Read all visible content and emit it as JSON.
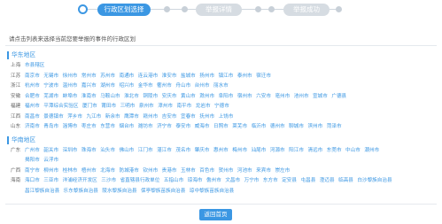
{
  "stepper": {
    "steps": [
      {
        "label": "行政区划选择",
        "active": true
      },
      {
        "label": "举报详情",
        "active": false
      },
      {
        "label": "举报成功",
        "active": false
      }
    ]
  },
  "hint": "请点击列表来选择当前您要举报的事件的行政区划",
  "regions": [
    {
      "title": "华东地区",
      "provinces": [
        {
          "name": "上海",
          "cities": [
            "市县辖区"
          ]
        },
        {
          "name": "江苏",
          "cities": [
            "南京市",
            "无锡市",
            "徐州市",
            "常州市",
            "苏州市",
            "南通市",
            "连云港市",
            "淮安市",
            "盐城市",
            "扬州市",
            "镇江市",
            "泰州市",
            "宿迁市"
          ]
        },
        {
          "name": "浙江",
          "cities": [
            "杭州市",
            "宁波市",
            "温州市",
            "嘉兴市",
            "湖州市",
            "绍兴市",
            "金华市",
            "衢州市",
            "舟山市",
            "台州市",
            "丽水市"
          ]
        },
        {
          "name": "安徽",
          "cities": [
            "合肥市",
            "芜湖市",
            "蚌埠市",
            "淮南市",
            "马鞍山市",
            "淮北市",
            "铜陵市",
            "安庆市",
            "黄山市",
            "滁州市",
            "阜阳市",
            "宿州市",
            "六安市",
            "亳州市",
            "池州市",
            "宣城市",
            "广德县"
          ]
        },
        {
          "name": "福建",
          "cities": [
            "福州市",
            "平潭综合实验区",
            "厦门市",
            "莆田市",
            "三明市",
            "泉州市",
            "漳州市",
            "南平市",
            "龙岩市",
            "宁德市"
          ]
        },
        {
          "name": "江西",
          "cities": [
            "南昌市",
            "景德镇市",
            "萍乡市",
            "九江市",
            "新余市",
            "鹰潭市",
            "赣州市",
            "吉安市",
            "宜春市",
            "抚州市",
            "上饶市"
          ]
        },
        {
          "name": "山东",
          "cities": [
            "济南市",
            "青岛市",
            "淄博市",
            "枣庄市",
            "东营市",
            "烟台市",
            "潍坊市",
            "济宁市",
            "泰安市",
            "威海市",
            "日照市",
            "莱芜市",
            "临沂市",
            "德州市",
            "聊城市",
            "滨州市",
            "菏泽市"
          ]
        }
      ]
    },
    {
      "title": "华南地区",
      "provinces": [
        {
          "name": "广东",
          "cities": [
            "广州市",
            "韶关市",
            "深圳市",
            "珠海市",
            "汕头市",
            "佛山市",
            "江门市",
            "湛江市",
            "茂名市",
            "肇庆市",
            "惠州市",
            "梅州市",
            "汕尾市",
            "河源市",
            "阳江市",
            "清远市",
            "东莞市",
            "中山市",
            "潮州市"
          ]
        },
        {
          "name": "",
          "cities": [
            "揭阳市",
            "云浮市"
          ]
        },
        {
          "name": "广西",
          "cities": [
            "南宁市",
            "柳州市",
            "桂林市",
            "梧州市",
            "北海市",
            "防城港市",
            "钦州市",
            "贵港市",
            "玉林市",
            "百色市",
            "贺州市",
            "河池市",
            "来宾市",
            "崇左市"
          ]
        },
        {
          "name": "海南",
          "cities": [
            "海口市",
            "三亚市",
            "洋浦经济开发区",
            "三沙市",
            "省直辖县行政单位",
            "五指山市",
            "琼海市",
            "儋州市",
            "文昌市",
            "万宁市",
            "东方市",
            "定安县",
            "屯昌县",
            "澄迈县",
            "临高县",
            "白沙黎族自治县"
          ]
        },
        {
          "name": "",
          "cities": [
            "昌江黎族自治县",
            "乐东黎族自治县",
            "陵水黎族自治县",
            "保亭黎族苗族自治县",
            "琼中黎族苗族自治县"
          ]
        }
      ]
    }
  ],
  "back_button": "返回首页",
  "colors": {
    "accent": "#3b97e3",
    "inactive": "#d6dce2"
  }
}
